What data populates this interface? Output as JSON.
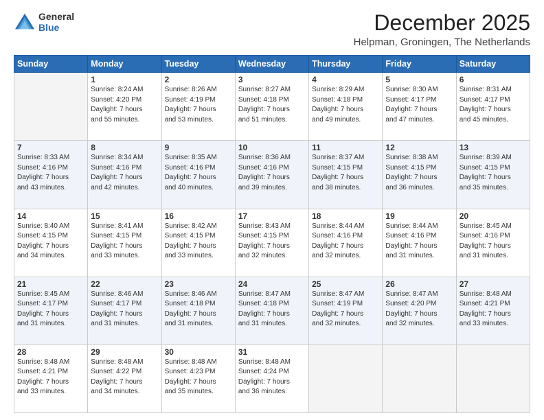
{
  "header": {
    "logo_line1": "General",
    "logo_line2": "Blue",
    "month_title": "December 2025",
    "location": "Helpman, Groningen, The Netherlands"
  },
  "weekdays": [
    "Sunday",
    "Monday",
    "Tuesday",
    "Wednesday",
    "Thursday",
    "Friday",
    "Saturday"
  ],
  "weeks": [
    {
      "days": [
        {
          "num": "",
          "info": ""
        },
        {
          "num": "1",
          "info": "Sunrise: 8:24 AM\nSunset: 4:20 PM\nDaylight: 7 hours\nand 55 minutes."
        },
        {
          "num": "2",
          "info": "Sunrise: 8:26 AM\nSunset: 4:19 PM\nDaylight: 7 hours\nand 53 minutes."
        },
        {
          "num": "3",
          "info": "Sunrise: 8:27 AM\nSunset: 4:18 PM\nDaylight: 7 hours\nand 51 minutes."
        },
        {
          "num": "4",
          "info": "Sunrise: 8:29 AM\nSunset: 4:18 PM\nDaylight: 7 hours\nand 49 minutes."
        },
        {
          "num": "5",
          "info": "Sunrise: 8:30 AM\nSunset: 4:17 PM\nDaylight: 7 hours\nand 47 minutes."
        },
        {
          "num": "6",
          "info": "Sunrise: 8:31 AM\nSunset: 4:17 PM\nDaylight: 7 hours\nand 45 minutes."
        }
      ]
    },
    {
      "days": [
        {
          "num": "7",
          "info": "Sunrise: 8:33 AM\nSunset: 4:16 PM\nDaylight: 7 hours\nand 43 minutes."
        },
        {
          "num": "8",
          "info": "Sunrise: 8:34 AM\nSunset: 4:16 PM\nDaylight: 7 hours\nand 42 minutes."
        },
        {
          "num": "9",
          "info": "Sunrise: 8:35 AM\nSunset: 4:16 PM\nDaylight: 7 hours\nand 40 minutes."
        },
        {
          "num": "10",
          "info": "Sunrise: 8:36 AM\nSunset: 4:16 PM\nDaylight: 7 hours\nand 39 minutes."
        },
        {
          "num": "11",
          "info": "Sunrise: 8:37 AM\nSunset: 4:15 PM\nDaylight: 7 hours\nand 38 minutes."
        },
        {
          "num": "12",
          "info": "Sunrise: 8:38 AM\nSunset: 4:15 PM\nDaylight: 7 hours\nand 36 minutes."
        },
        {
          "num": "13",
          "info": "Sunrise: 8:39 AM\nSunset: 4:15 PM\nDaylight: 7 hours\nand 35 minutes."
        }
      ]
    },
    {
      "days": [
        {
          "num": "14",
          "info": "Sunrise: 8:40 AM\nSunset: 4:15 PM\nDaylight: 7 hours\nand 34 minutes."
        },
        {
          "num": "15",
          "info": "Sunrise: 8:41 AM\nSunset: 4:15 PM\nDaylight: 7 hours\nand 33 minutes."
        },
        {
          "num": "16",
          "info": "Sunrise: 8:42 AM\nSunset: 4:15 PM\nDaylight: 7 hours\nand 33 minutes."
        },
        {
          "num": "17",
          "info": "Sunrise: 8:43 AM\nSunset: 4:15 PM\nDaylight: 7 hours\nand 32 minutes."
        },
        {
          "num": "18",
          "info": "Sunrise: 8:44 AM\nSunset: 4:16 PM\nDaylight: 7 hours\nand 32 minutes."
        },
        {
          "num": "19",
          "info": "Sunrise: 8:44 AM\nSunset: 4:16 PM\nDaylight: 7 hours\nand 31 minutes."
        },
        {
          "num": "20",
          "info": "Sunrise: 8:45 AM\nSunset: 4:16 PM\nDaylight: 7 hours\nand 31 minutes."
        }
      ]
    },
    {
      "days": [
        {
          "num": "21",
          "info": "Sunrise: 8:45 AM\nSunset: 4:17 PM\nDaylight: 7 hours\nand 31 minutes."
        },
        {
          "num": "22",
          "info": "Sunrise: 8:46 AM\nSunset: 4:17 PM\nDaylight: 7 hours\nand 31 minutes."
        },
        {
          "num": "23",
          "info": "Sunrise: 8:46 AM\nSunset: 4:18 PM\nDaylight: 7 hours\nand 31 minutes."
        },
        {
          "num": "24",
          "info": "Sunrise: 8:47 AM\nSunset: 4:18 PM\nDaylight: 7 hours\nand 31 minutes."
        },
        {
          "num": "25",
          "info": "Sunrise: 8:47 AM\nSunset: 4:19 PM\nDaylight: 7 hours\nand 32 minutes."
        },
        {
          "num": "26",
          "info": "Sunrise: 8:47 AM\nSunset: 4:20 PM\nDaylight: 7 hours\nand 32 minutes."
        },
        {
          "num": "27",
          "info": "Sunrise: 8:48 AM\nSunset: 4:21 PM\nDaylight: 7 hours\nand 33 minutes."
        }
      ]
    },
    {
      "days": [
        {
          "num": "28",
          "info": "Sunrise: 8:48 AM\nSunset: 4:21 PM\nDaylight: 7 hours\nand 33 minutes."
        },
        {
          "num": "29",
          "info": "Sunrise: 8:48 AM\nSunset: 4:22 PM\nDaylight: 7 hours\nand 34 minutes."
        },
        {
          "num": "30",
          "info": "Sunrise: 8:48 AM\nSunset: 4:23 PM\nDaylight: 7 hours\nand 35 minutes."
        },
        {
          "num": "31",
          "info": "Sunrise: 8:48 AM\nSunset: 4:24 PM\nDaylight: 7 hours\nand 36 minutes."
        },
        {
          "num": "",
          "info": ""
        },
        {
          "num": "",
          "info": ""
        },
        {
          "num": "",
          "info": ""
        }
      ]
    }
  ]
}
